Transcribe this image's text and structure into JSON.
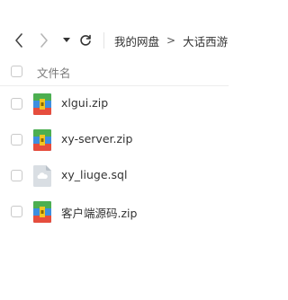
{
  "toolbar": {
    "back_icon": "chevron-left-icon",
    "forward_icon": "chevron-right-icon",
    "history_icon": "caret-down-icon",
    "refresh_icon": "refresh-icon"
  },
  "breadcrumb": {
    "root": "我的网盘",
    "separator": ">",
    "current": "大话西游"
  },
  "list": {
    "column_name": "文件名",
    "files": [
      {
        "name": "xlgui.zip",
        "icon": "zip-archive-icon"
      },
      {
        "name": "xy-server.zip",
        "icon": "zip-archive-icon"
      },
      {
        "name": "xy_liuge.sql",
        "icon": "generic-file-icon"
      },
      {
        "name": "客户端源码.zip",
        "icon": "zip-archive-icon"
      }
    ]
  },
  "colors": {
    "accent": "#3b82f6",
    "zip_red": "#e64d3d",
    "zip_green": "#4caf50",
    "zip_blue": "#3d8fe0",
    "zip_yellow": "#f3c623",
    "generic_file": "#cfd6dd"
  }
}
